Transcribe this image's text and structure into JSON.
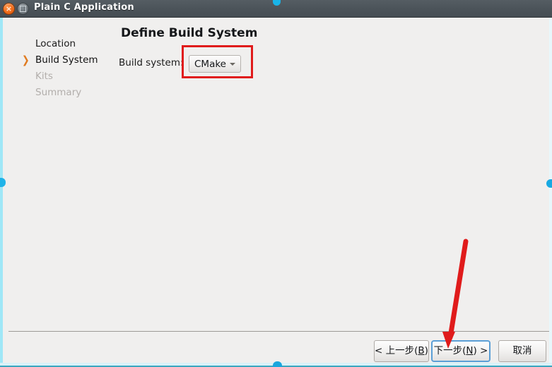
{
  "window": {
    "title": "Plain C Application",
    "close_icon": "close-icon",
    "maximize_icon": "maximize-icon",
    "close_glyph": "×"
  },
  "sidebar": {
    "marker_icon": "chevron-right-icon",
    "items": [
      {
        "label": "Location",
        "state": "done"
      },
      {
        "label": "Build System",
        "state": "current"
      },
      {
        "label": "Kits",
        "state": "disabled"
      },
      {
        "label": "Summary",
        "state": "disabled"
      }
    ]
  },
  "main": {
    "title": "Define Build System",
    "field": {
      "label": "Build system:",
      "value": "CMake",
      "arrow_icon": "chevron-down-icon",
      "options": [
        "CMake"
      ]
    }
  },
  "footer": {
    "buttons": [
      {
        "name": "back-button",
        "label": "< 上一步(B)",
        "default": false
      },
      {
        "name": "next-button",
        "label": "下一步(N) >",
        "default": true
      },
      {
        "name": "cancel-button",
        "label": "取消",
        "default": false
      }
    ]
  },
  "annotations": {
    "highlight_box_target": "build-system-combobox",
    "arrow_target": "next-button",
    "color": "#e01b1b"
  },
  "colors": {
    "titlebar": "#4b5359",
    "window_bg": "#f0efee",
    "accent_cyan": "#18b4e8",
    "marker_orange": "#e07b20",
    "default_button_border": "#5b9fd6",
    "annotation_red": "#e01b1b",
    "disabled_text": "#b2aeab"
  }
}
